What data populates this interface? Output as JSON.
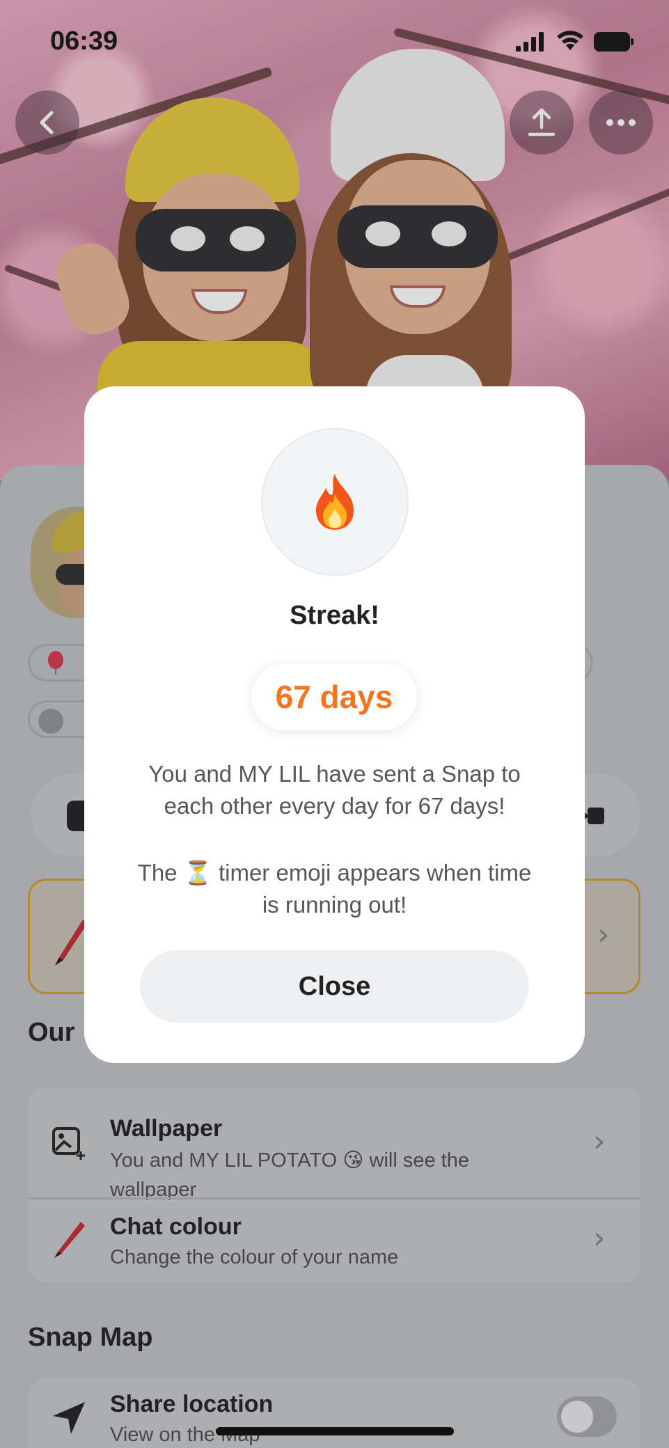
{
  "status_bar": {
    "time": "06:39"
  },
  "modal": {
    "flame_emoji": "🔥",
    "title": "Streak!",
    "days_label": "67 days",
    "message_line1": "You and MY LIL have sent a Snap to",
    "message_line2": "each other every day for 67 days!",
    "timer_line1": "The ⏳ timer emoji appears when time",
    "timer_line2": "is running out!",
    "close_label": "Close"
  },
  "sections": {
    "our_title_partial": "Our",
    "snap_map_title": "Snap Map"
  },
  "settings": {
    "wallpaper_title": "Wallpaper",
    "wallpaper_sub_line1": "You and MY LIL POTATO 😘 will see the",
    "wallpaper_sub_line2": "wallpaper",
    "chat_colour_title": "Chat colour",
    "chat_colour_sub": "Change the colour of your name",
    "share_location_title": "Share location",
    "share_location_sub": "View on the Map"
  },
  "colors": {
    "streak_orange": "#f5751f",
    "modal_bg": "#ffffff",
    "close_button_bg": "#edeff1"
  },
  "icons": [
    "back-icon",
    "share-icon",
    "more-icon",
    "flame-icon",
    "wallpaper-icon",
    "crayon-icon",
    "location-arrow-icon"
  ]
}
